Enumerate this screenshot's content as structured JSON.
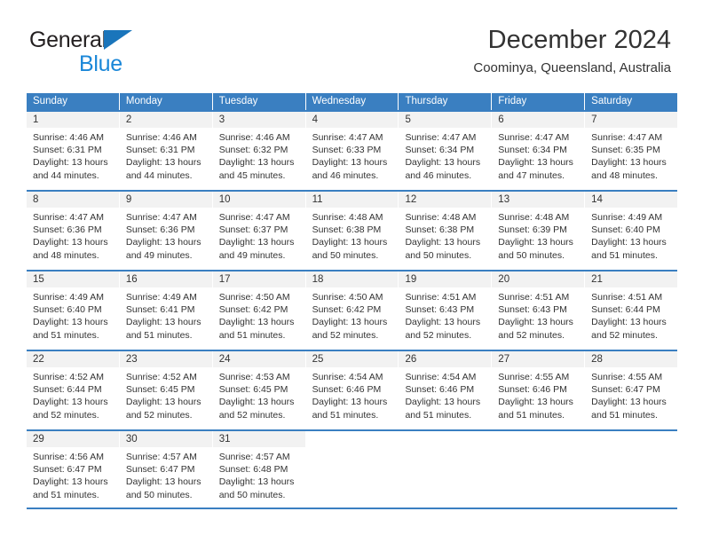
{
  "brand": {
    "name_top": "General",
    "name_bottom": "Blue",
    "triangle_color": "#1a75bb",
    "blue_color": "#1a87d8"
  },
  "header": {
    "title": "December 2024",
    "subtitle": "Coominya, Queensland, Australia"
  },
  "theme": {
    "header_blue": "#3a7fc1",
    "daynum_band": "#f2f2f2",
    "text": "#333333"
  },
  "weekdays": [
    "Sunday",
    "Monday",
    "Tuesday",
    "Wednesday",
    "Thursday",
    "Friday",
    "Saturday"
  ],
  "weeks": [
    [
      {
        "day": "1",
        "sunrise": "Sunrise: 4:46 AM",
        "sunset": "Sunset: 6:31 PM",
        "daylight1": "Daylight: 13 hours",
        "daylight2": "and 44 minutes."
      },
      {
        "day": "2",
        "sunrise": "Sunrise: 4:46 AM",
        "sunset": "Sunset: 6:31 PM",
        "daylight1": "Daylight: 13 hours",
        "daylight2": "and 44 minutes."
      },
      {
        "day": "3",
        "sunrise": "Sunrise: 4:46 AM",
        "sunset": "Sunset: 6:32 PM",
        "daylight1": "Daylight: 13 hours",
        "daylight2": "and 45 minutes."
      },
      {
        "day": "4",
        "sunrise": "Sunrise: 4:47 AM",
        "sunset": "Sunset: 6:33 PM",
        "daylight1": "Daylight: 13 hours",
        "daylight2": "and 46 minutes."
      },
      {
        "day": "5",
        "sunrise": "Sunrise: 4:47 AM",
        "sunset": "Sunset: 6:34 PM",
        "daylight1": "Daylight: 13 hours",
        "daylight2": "and 46 minutes."
      },
      {
        "day": "6",
        "sunrise": "Sunrise: 4:47 AM",
        "sunset": "Sunset: 6:34 PM",
        "daylight1": "Daylight: 13 hours",
        "daylight2": "and 47 minutes."
      },
      {
        "day": "7",
        "sunrise": "Sunrise: 4:47 AM",
        "sunset": "Sunset: 6:35 PM",
        "daylight1": "Daylight: 13 hours",
        "daylight2": "and 48 minutes."
      }
    ],
    [
      {
        "day": "8",
        "sunrise": "Sunrise: 4:47 AM",
        "sunset": "Sunset: 6:36 PM",
        "daylight1": "Daylight: 13 hours",
        "daylight2": "and 48 minutes."
      },
      {
        "day": "9",
        "sunrise": "Sunrise: 4:47 AM",
        "sunset": "Sunset: 6:36 PM",
        "daylight1": "Daylight: 13 hours",
        "daylight2": "and 49 minutes."
      },
      {
        "day": "10",
        "sunrise": "Sunrise: 4:47 AM",
        "sunset": "Sunset: 6:37 PM",
        "daylight1": "Daylight: 13 hours",
        "daylight2": "and 49 minutes."
      },
      {
        "day": "11",
        "sunrise": "Sunrise: 4:48 AM",
        "sunset": "Sunset: 6:38 PM",
        "daylight1": "Daylight: 13 hours",
        "daylight2": "and 50 minutes."
      },
      {
        "day": "12",
        "sunrise": "Sunrise: 4:48 AM",
        "sunset": "Sunset: 6:38 PM",
        "daylight1": "Daylight: 13 hours",
        "daylight2": "and 50 minutes."
      },
      {
        "day": "13",
        "sunrise": "Sunrise: 4:48 AM",
        "sunset": "Sunset: 6:39 PM",
        "daylight1": "Daylight: 13 hours",
        "daylight2": "and 50 minutes."
      },
      {
        "day": "14",
        "sunrise": "Sunrise: 4:49 AM",
        "sunset": "Sunset: 6:40 PM",
        "daylight1": "Daylight: 13 hours",
        "daylight2": "and 51 minutes."
      }
    ],
    [
      {
        "day": "15",
        "sunrise": "Sunrise: 4:49 AM",
        "sunset": "Sunset: 6:40 PM",
        "daylight1": "Daylight: 13 hours",
        "daylight2": "and 51 minutes."
      },
      {
        "day": "16",
        "sunrise": "Sunrise: 4:49 AM",
        "sunset": "Sunset: 6:41 PM",
        "daylight1": "Daylight: 13 hours",
        "daylight2": "and 51 minutes."
      },
      {
        "day": "17",
        "sunrise": "Sunrise: 4:50 AM",
        "sunset": "Sunset: 6:42 PM",
        "daylight1": "Daylight: 13 hours",
        "daylight2": "and 51 minutes."
      },
      {
        "day": "18",
        "sunrise": "Sunrise: 4:50 AM",
        "sunset": "Sunset: 6:42 PM",
        "daylight1": "Daylight: 13 hours",
        "daylight2": "and 52 minutes."
      },
      {
        "day": "19",
        "sunrise": "Sunrise: 4:51 AM",
        "sunset": "Sunset: 6:43 PM",
        "daylight1": "Daylight: 13 hours",
        "daylight2": "and 52 minutes."
      },
      {
        "day": "20",
        "sunrise": "Sunrise: 4:51 AM",
        "sunset": "Sunset: 6:43 PM",
        "daylight1": "Daylight: 13 hours",
        "daylight2": "and 52 minutes."
      },
      {
        "day": "21",
        "sunrise": "Sunrise: 4:51 AM",
        "sunset": "Sunset: 6:44 PM",
        "daylight1": "Daylight: 13 hours",
        "daylight2": "and 52 minutes."
      }
    ],
    [
      {
        "day": "22",
        "sunrise": "Sunrise: 4:52 AM",
        "sunset": "Sunset: 6:44 PM",
        "daylight1": "Daylight: 13 hours",
        "daylight2": "and 52 minutes."
      },
      {
        "day": "23",
        "sunrise": "Sunrise: 4:52 AM",
        "sunset": "Sunset: 6:45 PM",
        "daylight1": "Daylight: 13 hours",
        "daylight2": "and 52 minutes."
      },
      {
        "day": "24",
        "sunrise": "Sunrise: 4:53 AM",
        "sunset": "Sunset: 6:45 PM",
        "daylight1": "Daylight: 13 hours",
        "daylight2": "and 52 minutes."
      },
      {
        "day": "25",
        "sunrise": "Sunrise: 4:54 AM",
        "sunset": "Sunset: 6:46 PM",
        "daylight1": "Daylight: 13 hours",
        "daylight2": "and 51 minutes."
      },
      {
        "day": "26",
        "sunrise": "Sunrise: 4:54 AM",
        "sunset": "Sunset: 6:46 PM",
        "daylight1": "Daylight: 13 hours",
        "daylight2": "and 51 minutes."
      },
      {
        "day": "27",
        "sunrise": "Sunrise: 4:55 AM",
        "sunset": "Sunset: 6:46 PM",
        "daylight1": "Daylight: 13 hours",
        "daylight2": "and 51 minutes."
      },
      {
        "day": "28",
        "sunrise": "Sunrise: 4:55 AM",
        "sunset": "Sunset: 6:47 PM",
        "daylight1": "Daylight: 13 hours",
        "daylight2": "and 51 minutes."
      }
    ],
    [
      {
        "day": "29",
        "sunrise": "Sunrise: 4:56 AM",
        "sunset": "Sunset: 6:47 PM",
        "daylight1": "Daylight: 13 hours",
        "daylight2": "and 51 minutes."
      },
      {
        "day": "30",
        "sunrise": "Sunrise: 4:57 AM",
        "sunset": "Sunset: 6:47 PM",
        "daylight1": "Daylight: 13 hours",
        "daylight2": "and 50 minutes."
      },
      {
        "day": "31",
        "sunrise": "Sunrise: 4:57 AM",
        "sunset": "Sunset: 6:48 PM",
        "daylight1": "Daylight: 13 hours",
        "daylight2": "and 50 minutes."
      },
      {
        "day": "",
        "sunrise": "",
        "sunset": "",
        "daylight1": "",
        "daylight2": ""
      },
      {
        "day": "",
        "sunrise": "",
        "sunset": "",
        "daylight1": "",
        "daylight2": ""
      },
      {
        "day": "",
        "sunrise": "",
        "sunset": "",
        "daylight1": "",
        "daylight2": ""
      },
      {
        "day": "",
        "sunrise": "",
        "sunset": "",
        "daylight1": "",
        "daylight2": ""
      }
    ]
  ]
}
